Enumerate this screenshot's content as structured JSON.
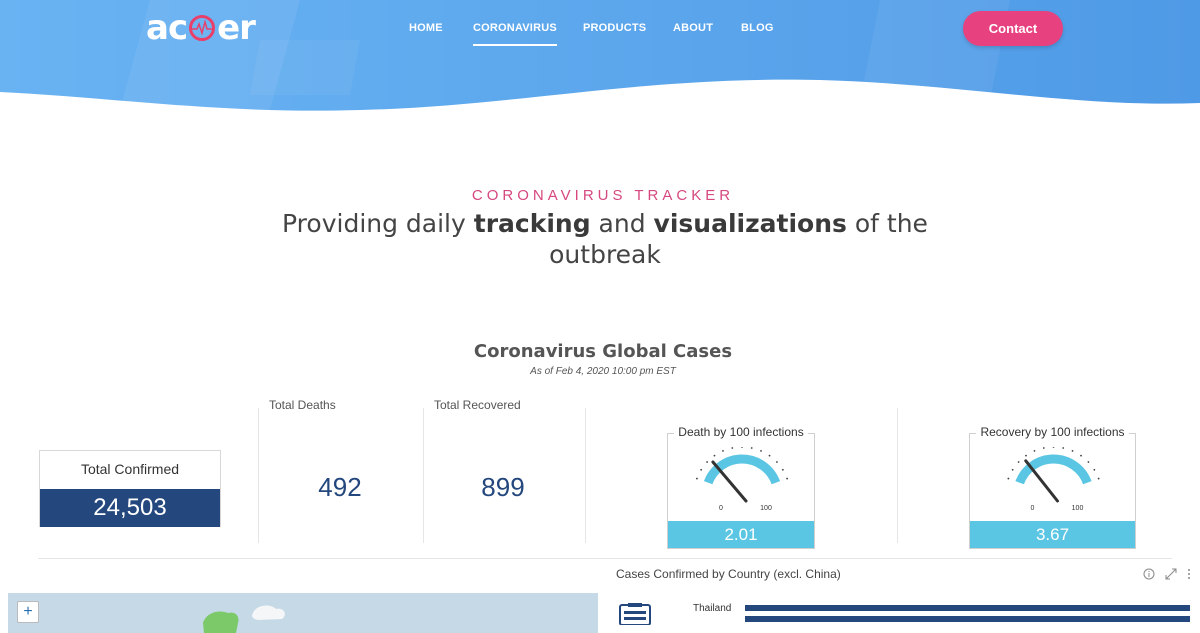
{
  "header": {
    "logo": {
      "text_left": "ac",
      "text_right": "er"
    },
    "nav": [
      {
        "label": "HOME",
        "active": false
      },
      {
        "label": "CORONAVIRUS",
        "active": true
      },
      {
        "label": "PRODUCTS",
        "active": false
      },
      {
        "label": "ABOUT",
        "active": false
      },
      {
        "label": "BLOG",
        "active": false
      }
    ],
    "contact_label": "Contact",
    "colors": {
      "wave": "#5aa5ec",
      "contact": "#e7427f"
    }
  },
  "hero": {
    "kicker": "CORONAVIRUS TRACKER",
    "headline": {
      "part1": "Providing daily ",
      "bold1": "tracking",
      "part2": " and ",
      "bold2": "visualizations",
      "part3": " of the outbreak"
    }
  },
  "dashboard": {
    "title": "Coronavirus Global Cases",
    "subtitle": "As of Feb 4, 2020 10:00 pm EST",
    "confirmed": {
      "label": "Total Confirmed",
      "value": "24,503"
    },
    "deaths": {
      "label": "Total Deaths",
      "value": "492"
    },
    "recovered": {
      "label": "Total Recovered",
      "value": "899"
    },
    "death_gauge": {
      "label": "Death by 100 infections",
      "value": "2.01",
      "min": "0",
      "max": "100",
      "level": 2.01
    },
    "recovery_gauge": {
      "label": "Recovery by 100 infections",
      "value": "3.67",
      "min": "0",
      "max": "100",
      "level": 3.67
    },
    "country_chart": {
      "title": "Cases Confirmed by Country (excl. China)",
      "first_row_label": "Thailand",
      "icons": {
        "info": "info-icon",
        "expand": "expand-icon",
        "more": "more-icon"
      }
    },
    "map": {
      "zoom_in": "+"
    },
    "colors": {
      "navy": "#24477d",
      "gauge": "#5bc6e3"
    }
  }
}
